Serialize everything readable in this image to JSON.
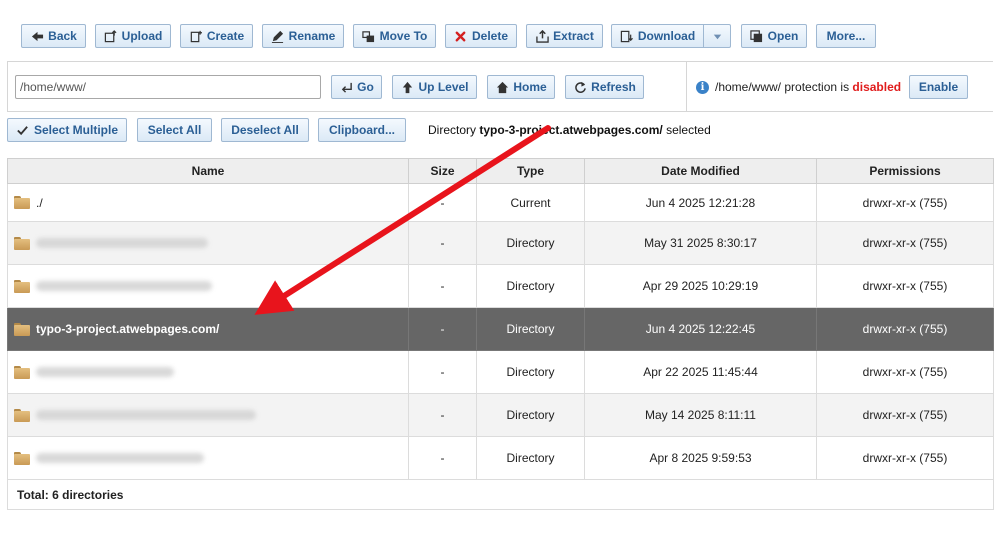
{
  "toolbar": {
    "back": "Back",
    "upload": "Upload",
    "create": "Create",
    "rename": "Rename",
    "move_to": "Move To",
    "delete": "Delete",
    "extract": "Extract",
    "download": "Download",
    "open": "Open",
    "more": "More..."
  },
  "nav": {
    "path_value": "/home/www/",
    "go": "Go",
    "up_level": "Up Level",
    "home": "Home",
    "refresh": "Refresh"
  },
  "protection": {
    "path": "/home/www/",
    "text": "protection is",
    "status": "disabled",
    "enable": "Enable"
  },
  "selection": {
    "select_multiple": "Select Multiple",
    "select_all": "Select All",
    "deselect_all": "Deselect All",
    "clipboard": "Clipboard...",
    "msg_prefix": "Directory",
    "msg_name": "typo-3-project.atwebpages.com/",
    "msg_suffix": "selected"
  },
  "table": {
    "headers": [
      "Name",
      "Size",
      "Type",
      "Date Modified",
      "Permissions"
    ],
    "rows": [
      {
        "name": "./",
        "size": "-",
        "type": "Current",
        "date": "Jun 4 2025 12:21:28",
        "perm": "drwxr-xr-x (755)"
      },
      {
        "name": "",
        "size": "-",
        "type": "Directory",
        "date": "May 31 2025 8:30:17",
        "perm": "drwxr-xr-x (755)"
      },
      {
        "name": "",
        "size": "-",
        "type": "Directory",
        "date": "Apr 29 2025 10:29:19",
        "perm": "drwxr-xr-x (755)"
      },
      {
        "name": "typo-3-project.atwebpages.com/",
        "size": "-",
        "type": "Directory",
        "date": "Jun 4 2025 12:22:45",
        "perm": "drwxr-xr-x (755)"
      },
      {
        "name": "",
        "size": "-",
        "type": "Directory",
        "date": "Apr 22 2025 11:45:44",
        "perm": "drwxr-xr-x (755)"
      },
      {
        "name": "",
        "size": "-",
        "type": "Directory",
        "date": "May 14 2025 8:11:11",
        "perm": "drwxr-xr-x (755)"
      },
      {
        "name": "",
        "size": "-",
        "type": "Directory",
        "date": "Apr 8 2025 9:59:53",
        "perm": "drwxr-xr-x (755)"
      }
    ],
    "total": "Total: 6 directories"
  },
  "colors": {
    "accent": "#2b5f95",
    "selected_row": "#666666",
    "disabled": "#e01c1c",
    "arrow": "#e8141c"
  }
}
